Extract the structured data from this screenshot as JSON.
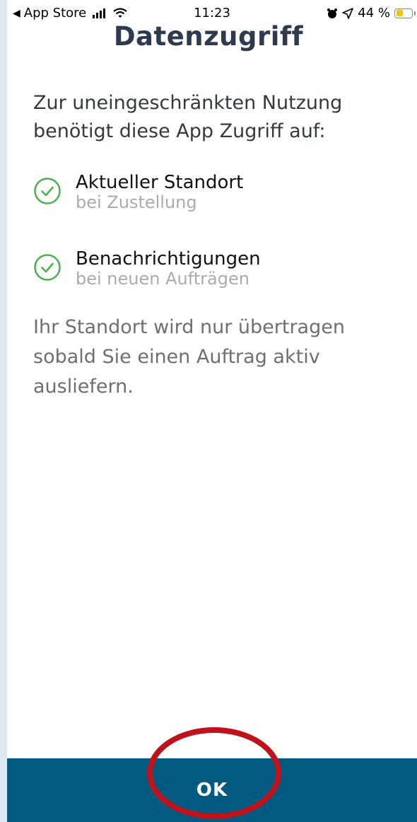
{
  "status_bar": {
    "back_label": "App Store",
    "time": "11:23",
    "battery_text": "44 %",
    "battery_level": 0.44
  },
  "page": {
    "title": "Datenzugriff",
    "intro_line1": "Zur uneingeschränkten Nutzung",
    "intro_line2": "benötigt diese App Zugriff auf:",
    "permissions": [
      {
        "title": "Aktueller Standort",
        "subtitle": "bei Zustellung"
      },
      {
        "title": "Benachrichtigungen",
        "subtitle": "bei neuen Aufträgen"
      }
    ],
    "note_line1": "Ihr Standort wird nur übertragen",
    "note_line2": "sobald Sie einen Auftrag aktiv",
    "note_line3": "ausliefern."
  },
  "footer": {
    "ok_label": "OK"
  },
  "colors": {
    "accent": "#025a80",
    "check_green": "#4caf50",
    "annotation_red": "#c0121b"
  }
}
